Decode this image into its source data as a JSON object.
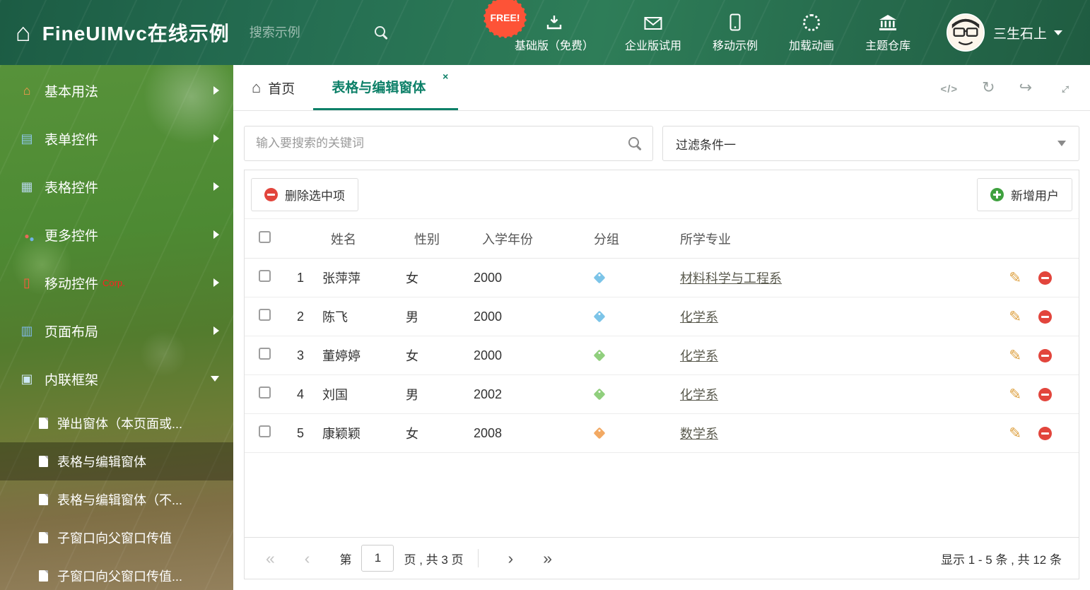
{
  "header": {
    "title": "FineUIMvc在线示例",
    "search_placeholder": "搜索示例",
    "free_badge": "FREE!",
    "nav": [
      {
        "label": "基础版（免费）",
        "icon": "download-icon"
      },
      {
        "label": "企业版试用",
        "icon": "envelope-icon"
      },
      {
        "label": "移动示例",
        "icon": "mobile-icon"
      },
      {
        "label": "加载动画",
        "icon": "spinner-icon"
      },
      {
        "label": "主题仓库",
        "icon": "theme-store-icon"
      }
    ],
    "username": "三生石上"
  },
  "sidebar": {
    "items": [
      {
        "label": "基本用法",
        "icon": "home-icon"
      },
      {
        "label": "表单控件",
        "icon": "form-icon"
      },
      {
        "label": "表格控件",
        "icon": "grid-icon"
      },
      {
        "label": "更多控件",
        "icon": "more-controls-icon"
      },
      {
        "label": "移动控件",
        "icon": "mobile-icon",
        "badge": "Corp."
      },
      {
        "label": "页面布局",
        "icon": "layout-icon"
      },
      {
        "label": "内联框架",
        "icon": "iframe-icon"
      }
    ],
    "subitems": [
      {
        "label": "弹出窗体（本页面或..."
      },
      {
        "label": "表格与编辑窗体"
      },
      {
        "label": "表格与编辑窗体（不..."
      },
      {
        "label": "子窗口向父窗口传值"
      },
      {
        "label": "子窗口向父窗口传值..."
      }
    ]
  },
  "tabs": {
    "home_label": "首页",
    "active_label": "表格与编辑窗体"
  },
  "filter": {
    "search_placeholder": "输入要搜索的关键词",
    "dropdown_value": "过滤条件一"
  },
  "toolbar": {
    "delete_label": "删除选中项",
    "add_label": "新增用户"
  },
  "table": {
    "columns": {
      "name": "姓名",
      "gender": "性别",
      "year": "入学年份",
      "group": "分组",
      "major": "所学专业"
    },
    "rows": [
      {
        "num": "1",
        "name": "张萍萍",
        "gender": "女",
        "year": "2000",
        "tag_color": "#7cc4e8",
        "major": "材料科学与工程系"
      },
      {
        "num": "2",
        "name": "陈飞",
        "gender": "男",
        "year": "2000",
        "tag_color": "#7cc4e8",
        "major": "化学系"
      },
      {
        "num": "3",
        "name": "董婷婷",
        "gender": "女",
        "year": "2000",
        "tag_color": "#90cf7d",
        "major": "化学系"
      },
      {
        "num": "4",
        "name": "刘国",
        "gender": "男",
        "year": "2002",
        "tag_color": "#90cf7d",
        "major": "化学系"
      },
      {
        "num": "5",
        "name": "康颖颖",
        "gender": "女",
        "year": "2008",
        "tag_color": "#f2a963",
        "major": "数学系"
      }
    ]
  },
  "pager": {
    "prefix": "第",
    "page": "1",
    "suffix": "页 , 共 3 页",
    "summary": "显示 1 - 5 条 , 共 12 条"
  },
  "colors": {
    "accent": "#0d8068",
    "free_badge": "#fd5337"
  }
}
